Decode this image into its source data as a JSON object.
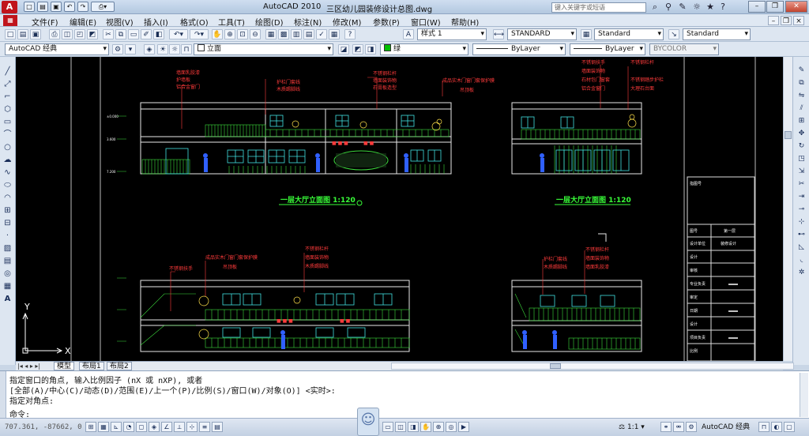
{
  "app": {
    "name": "AutoCAD 2010",
    "file": "三区幼儿园装修设计总图.dwg",
    "search_placeholder": "键入关键字或短语"
  },
  "menu": [
    "文件(F)",
    "编辑(E)",
    "视图(V)",
    "插入(I)",
    "格式(O)",
    "工具(T)",
    "绘图(D)",
    "标注(N)",
    "修改(M)",
    "参数(P)",
    "窗口(W)",
    "帮助(H)"
  ],
  "toolbar": {
    "text_style": "样式 1",
    "dim_style": "STANDARD",
    "table_style": "Standard",
    "multileader_style": "Standard",
    "workspace": "AutoCAD 经典",
    "layer": "立面",
    "color": "绿",
    "linetype": "ByLayer",
    "lineweight": "ByLayer",
    "plotstyle": "BYCOLOR"
  },
  "drawing": {
    "elevation_title_1": "一层大厅立面图  1:120",
    "elevation_title_2": "一层大厅立面图  1:120",
    "callouts_left_top": [
      "墙面乳胶漆",
      "护墙板",
      "铝合金窗门"
    ],
    "callouts_mid_a": [
      "护栏门套线",
      "木质踢脚线"
    ],
    "callouts_mid_b": [
      "不锈钢栏杆",
      "墙面装饰物",
      "石膏板造型"
    ],
    "callouts_mid_c": [
      "成品实木门窗门套保护膜",
      "吊顶板"
    ],
    "callouts_right_a": [
      "不锈钢扶手",
      "墙面装饰物",
      "石材包门窗套",
      "铝合金窗门"
    ],
    "callouts_right_b": [
      "不锈钢栏杆",
      "不锈钢踏步护栏",
      "大理石台面"
    ],
    "callouts_bottom_a": [
      "成品实木门窗门套保护膜",
      "吊顶板"
    ],
    "callouts_bottom_b": [
      "不锈钢扶手"
    ],
    "callouts_bottom_c": [
      "不锈钢栏杆",
      "墙面装饰物",
      "木质踢脚线"
    ],
    "callouts_bottom_d": [
      "护栏门套线",
      "木质踢脚线"
    ],
    "callouts_bottom_e": [
      "不锈钢栏杆",
      "墙面装饰物",
      "墙面乳胶漆"
    ],
    "title_block": [
      "指图号",
      "图号",
      "第一层",
      "设计单位",
      "装修设计",
      "设计",
      "审核",
      "专业负责",
      "审定",
      "日期",
      "设计",
      "项目负责",
      "比例"
    ]
  },
  "layout_tabs": [
    "模型",
    "布局1",
    "布局2"
  ],
  "command_lines": [
    "指定窗口的角点, 输入比例因子 (nX 或 nXP), 或者",
    "[全部(A)/中心(C)/动态(D)/范围(E)/上一个(P)/比例(S)/窗口(W)/对象(O)] <实时>:",
    "指定对角点:",
    "命令:"
  ],
  "status": {
    "coords": "707.361, -87662, 0",
    "annotation_scale": "1:1",
    "workspace": "AutoCAD 经典"
  },
  "ucs": {
    "y": "Y",
    "x": "X"
  }
}
